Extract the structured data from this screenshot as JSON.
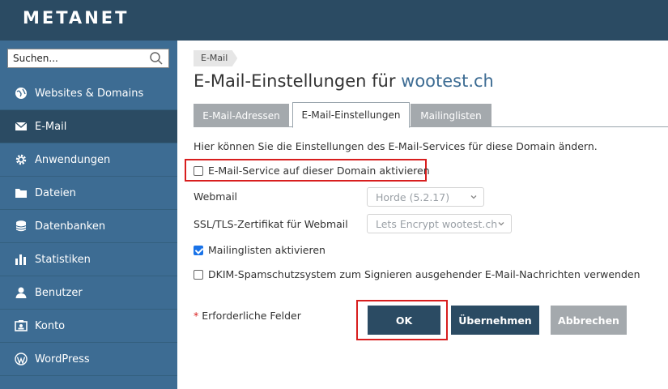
{
  "header": {
    "logo": "METANET"
  },
  "sidebar": {
    "search_placeholder": "Suchen...",
    "items": [
      {
        "label": "Websites & Domains",
        "icon": "globe-icon",
        "active": false
      },
      {
        "label": "E-Mail",
        "icon": "envelope-icon",
        "active": true
      },
      {
        "label": "Anwendungen",
        "icon": "gear-icon",
        "active": false
      },
      {
        "label": "Dateien",
        "icon": "folder-icon",
        "active": false
      },
      {
        "label": "Datenbanken",
        "icon": "database-icon",
        "active": false
      },
      {
        "label": "Statistiken",
        "icon": "bar-chart-icon",
        "active": false
      },
      {
        "label": "Benutzer",
        "icon": "user-icon",
        "active": false
      },
      {
        "label": "Konto",
        "icon": "id-card-icon",
        "active": false
      },
      {
        "label": "WordPress",
        "icon": "wordpress-icon",
        "active": false
      }
    ]
  },
  "main": {
    "breadcrumb": "E-Mail",
    "title_prefix": "E-Mail-Einstellungen für",
    "title_domain": "wootest.ch",
    "tabs": [
      {
        "label": "E-Mail-Adressen",
        "active": false
      },
      {
        "label": "E-Mail-Einstellungen",
        "active": true
      },
      {
        "label": "Mailinglisten",
        "active": false
      }
    ],
    "description": "Hier können Sie die Einstellungen des E-Mail-Services für diese Domain ändern.",
    "enable_mail_service": {
      "label": "E-Mail-Service auf dieser Domain aktivieren",
      "checked": false
    },
    "webmail": {
      "label": "Webmail",
      "value": "Horde (5.2.17)"
    },
    "ssl_cert": {
      "label": "SSL/TLS-Zertifikat für Webmail",
      "value": "Lets Encrypt wootest.ch"
    },
    "mailing_lists": {
      "label": "Mailinglisten aktivieren",
      "checked": true
    },
    "dkim": {
      "label": "DKIM-Spamschutzsystem zum Signieren ausgehender E-Mail-Nachrichten verwenden",
      "checked": false
    },
    "required_star": "*",
    "required_text": "Erforderliche Felder",
    "buttons": {
      "ok": "OK",
      "apply": "Übernehmen",
      "cancel": "Abbrechen"
    }
  },
  "colors": {
    "header": "#2b4b63",
    "sidebar": "#3d6c93",
    "highlight": "#d81e1e",
    "link": "#3d6c93"
  }
}
